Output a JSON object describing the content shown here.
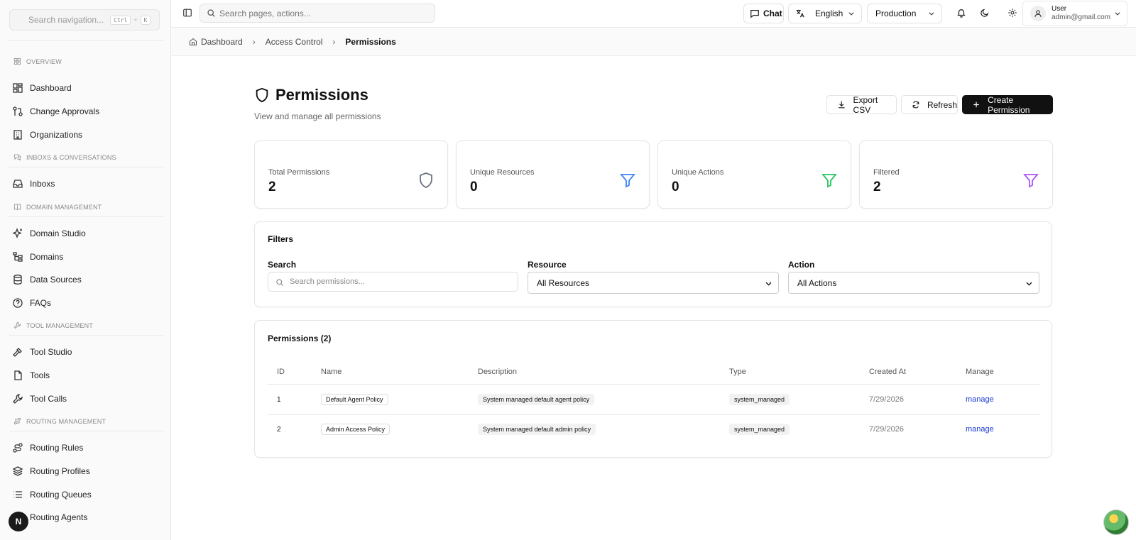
{
  "sidebar": {
    "search_placeholder": "Search navigation...",
    "shortcut_key1": "Ctrl",
    "shortcut_sep": "+",
    "shortcut_key2": "K",
    "sections": {
      "overview": "OVERVIEW",
      "inboxes": "INBOXS & CONVERSATIONS",
      "domain": "DOMAIN MANAGEMENT",
      "tool": "TOOL MANAGEMENT",
      "routing": "ROUTING MANAGEMENT"
    },
    "items": {
      "dashboard": "Dashboard",
      "change_approvals": "Change Approvals",
      "organizations": "Organizations",
      "inboxes": "Inboxs",
      "domain_studio": "Domain Studio",
      "domains": "Domains",
      "data_sources": "Data Sources",
      "faqs": "FAQs",
      "tool_studio": "Tool Studio",
      "tools": "Tools",
      "tool_calls": "Tool Calls",
      "routing_rules": "Routing Rules",
      "routing_profiles": "Routing Profiles",
      "routing_queues": "Routing Queues",
      "routing_agents": "Routing Agents"
    },
    "badge": "N"
  },
  "topbar": {
    "search_placeholder": "Search pages, actions...",
    "chat_label": "Chat",
    "language": "English",
    "environment": "Production",
    "user_name": "User",
    "user_email": "admin@gmail.com"
  },
  "breadcrumb": {
    "home": "Dashboard",
    "parent": "Access Control",
    "current": "Permissions"
  },
  "page": {
    "title": "Permissions",
    "subtitle": "View and manage all permissions",
    "export_label": "Export CSV",
    "refresh_label": "Refresh",
    "create_label": "Create Permission"
  },
  "stats": [
    {
      "label": "Total Permissions",
      "value": "2",
      "color": "#6b7280"
    },
    {
      "label": "Unique Resources",
      "value": "0",
      "color": "#3b82f6"
    },
    {
      "label": "Unique Actions",
      "value": "0",
      "color": "#22c55e"
    },
    {
      "label": "Filtered",
      "value": "2",
      "color": "#a855f7"
    }
  ],
  "filters": {
    "title": "Filters",
    "search_label": "Search",
    "search_placeholder": "Search permissions...",
    "resource_label": "Resource",
    "resource_value": "All Resources",
    "action_label": "Action",
    "action_value": "All Actions"
  },
  "table": {
    "title": "Permissions (2)",
    "columns": [
      "ID",
      "Name",
      "Description",
      "Type",
      "Created At",
      "Manage"
    ],
    "rows": [
      {
        "id": "1",
        "name": "Default Agent Policy",
        "description": "System managed default agent policy",
        "type": "system_managed",
        "created_at": "7/29/2026",
        "manage": "manage"
      },
      {
        "id": "2",
        "name": "Admin Access Policy",
        "description": "System managed default admin policy",
        "type": "system_managed",
        "created_at": "7/29/2026",
        "manage": "manage"
      }
    ]
  }
}
